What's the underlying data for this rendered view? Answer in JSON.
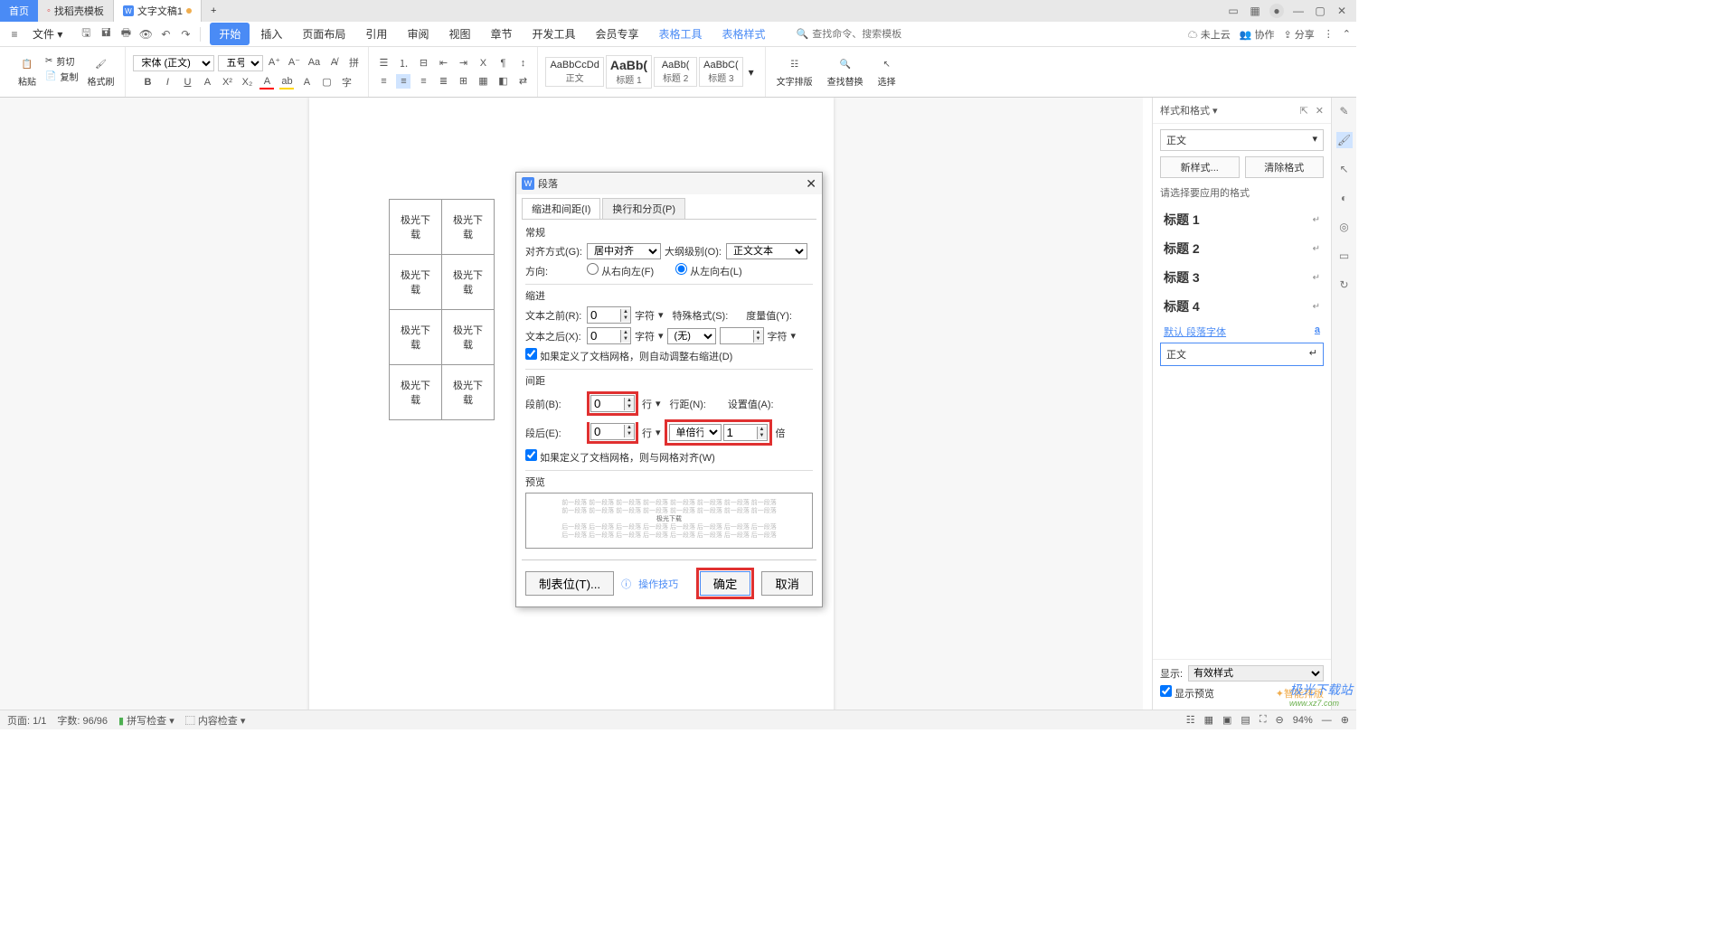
{
  "titlebar": {
    "home": "首页",
    "tab1": "找稻壳模板",
    "tab2": "文字文稿1",
    "plus": "+"
  },
  "menubar": {
    "file": "文件",
    "tabs": [
      "开始",
      "插入",
      "页面布局",
      "引用",
      "审阅",
      "视图",
      "章节",
      "开发工具",
      "会员专享",
      "表格工具",
      "表格样式"
    ],
    "search_placeholder": "查找命令、搜索模板",
    "cloud": "未上云",
    "collab": "协作",
    "share": "分享"
  },
  "ribbon": {
    "paste": "粘贴",
    "cut": "剪切",
    "copy": "复制",
    "format_painter": "格式刷",
    "font_name": "宋体 (正文)",
    "font_size": "五号",
    "styles": {
      "s1_preview": "AaBbCcDd",
      "s1_label": "正文",
      "s2_preview": "AaBb(",
      "s2_label": "标题 1",
      "s3_preview": "AaBb(",
      "s3_label": "标题 2",
      "s4_preview": "AaBbC(",
      "s4_label": "标题 3"
    },
    "text_layout": "文字排版",
    "find_replace": "查找替换",
    "select": "选择"
  },
  "doc": {
    "cell": "极光下载"
  },
  "dialog": {
    "title": "段落",
    "tab1": "缩进和间距(I)",
    "tab2": "换行和分页(P)",
    "section_general": "常规",
    "align_label": "对齐方式(G):",
    "align_value": "居中对齐",
    "outline_label": "大纲级别(O):",
    "outline_value": "正文文本",
    "direction_label": "方向:",
    "dir_rtl": "从右向左(F)",
    "dir_ltr": "从左向右(L)",
    "section_indent": "缩进",
    "indent_before_label": "文本之前(R):",
    "indent_before_value": "0",
    "indent_after_label": "文本之后(X):",
    "indent_after_value": "0",
    "unit_char": "字符",
    "special_label": "特殊格式(S):",
    "special_value": "(无)",
    "measure_label": "度量值(Y):",
    "indent_grid_check": "如果定义了文档网格，则自动调整右缩进(D)",
    "section_spacing": "间距",
    "space_before_label": "段前(B):",
    "space_before_value": "0",
    "space_after_label": "段后(E):",
    "space_after_value": "0",
    "unit_line": "行",
    "line_spacing_label": "行距(N):",
    "line_spacing_value": "单倍行距",
    "set_value_label": "设置值(A):",
    "set_value": "1",
    "unit_times": "倍",
    "spacing_grid_check": "如果定义了文档网格，则与网格对齐(W)",
    "preview_label": "预览",
    "preview_text": "极光下载",
    "tabs_btn": "制表位(T)...",
    "tips": "操作技巧",
    "ok": "确定",
    "cancel": "取消"
  },
  "right_panel": {
    "title": "样式和格式",
    "current": "正文",
    "new_style": "新样式...",
    "clear_format": "清除格式",
    "choose_label": "请选择要应用的格式",
    "items": [
      {
        "name": "标题 1"
      },
      {
        "name": "标题 2"
      },
      {
        "name": "标题 3"
      },
      {
        "name": "标题 4"
      }
    ],
    "default_para_font": "默认 段落字体",
    "default_mark": "a",
    "body": "正文",
    "show_label": "显示:",
    "show_value": "有效样式",
    "show_preview": "显示预览",
    "smart_layout": "智能排版"
  },
  "statusbar": {
    "page": "页面: 1/1",
    "words": "字数: 96/96",
    "spellcheck": "拼写检查",
    "content_check": "内容检查",
    "zoom": "94%"
  },
  "watermark": {
    "main": "极光下载站",
    "sub": "www.xz7.com"
  }
}
